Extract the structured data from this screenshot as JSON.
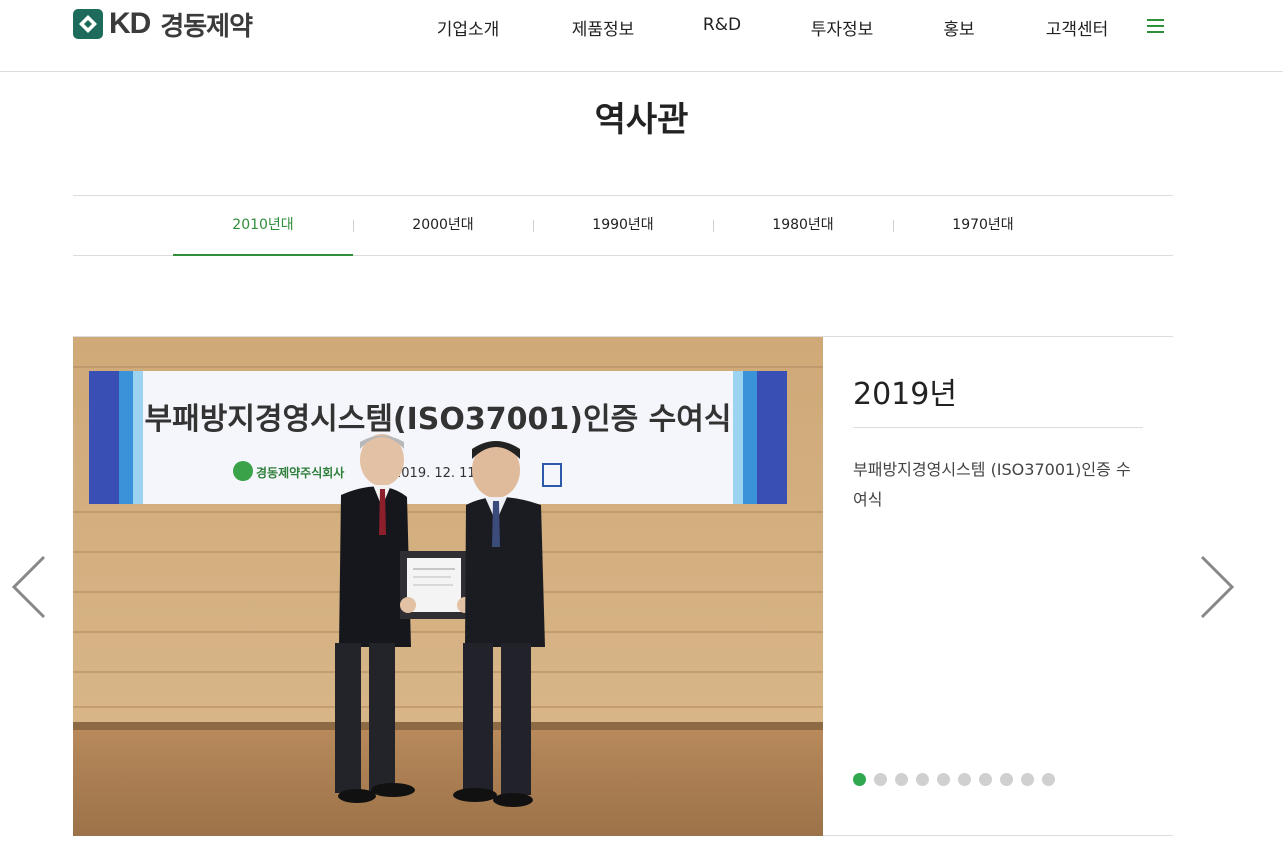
{
  "header": {
    "logo_text": "KD",
    "logo_korean": "경동제약",
    "nav": [
      "기업소개",
      "제품정보",
      "R&D",
      "투자정보",
      "홍보",
      "고객센터"
    ],
    "menu_icon": "hamburger-menu-icon"
  },
  "page": {
    "title": "역사관"
  },
  "tabs": [
    {
      "label": "2010년대",
      "active": true
    },
    {
      "label": "2000년대",
      "active": false
    },
    {
      "label": "1990년대",
      "active": false
    },
    {
      "label": "1980년대",
      "active": false
    },
    {
      "label": "1970년대",
      "active": false
    }
  ],
  "slide": {
    "year": "2019년",
    "description": "부패방지경영시스템 (ISO37001)인증 수여식",
    "photo": {
      "banner_text": "부패방지경영시스템(ISO37001)인증  수여식",
      "banner_company": "경동제약주식회사",
      "banner_date": "2019. 12. 11(수"
    },
    "dots_total": 10,
    "dots_active_index": 0
  },
  "colors": {
    "accent": "#2f8f3b",
    "dot_active": "#2fa84f",
    "dot_inactive": "#d0d0d0",
    "text": "#222222"
  },
  "icons": {
    "prev": "chevron-left-icon",
    "next": "chevron-right-icon"
  }
}
